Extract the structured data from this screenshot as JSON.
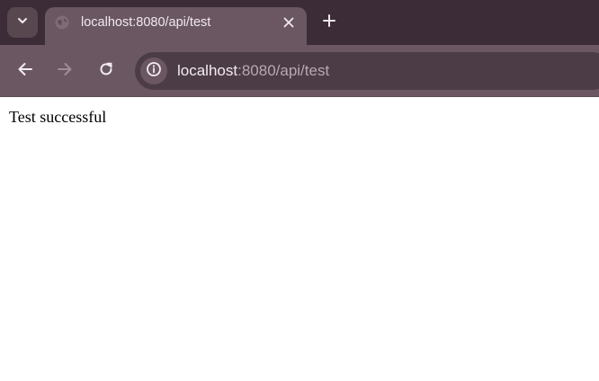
{
  "tab": {
    "title": "localhost:8080/api/test",
    "favicon": "globe-icon",
    "close_icon": "close-icon"
  },
  "tab_strip": {
    "tab_search_icon": "chevron-down-icon",
    "new_tab_icon": "plus-icon"
  },
  "toolbar": {
    "back_icon": "arrow-left-icon",
    "forward_icon": "arrow-right-icon",
    "reload_icon": "reload-icon",
    "site_info_icon": "info-icon"
  },
  "address_bar": {
    "host": "localhost",
    "rest": ":8080/api/test"
  },
  "page": {
    "text": "Test successful"
  },
  "colors": {
    "tab_strip": "#3b2c37",
    "toolbar": "#6a5762",
    "omnibox": "#4c3c46",
    "page_bg": "#ffffff"
  }
}
